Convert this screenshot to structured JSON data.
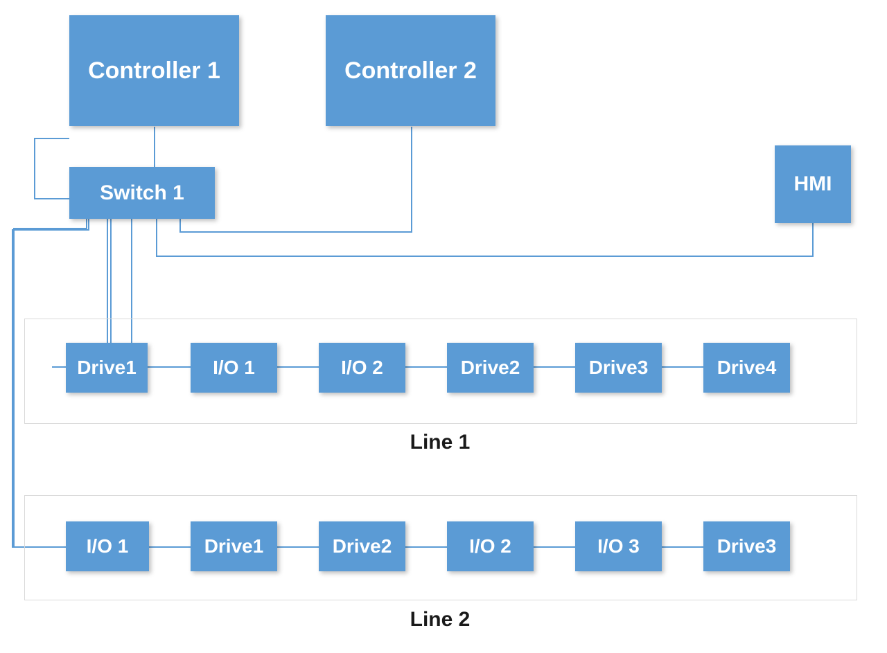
{
  "diagram": {
    "type": "network-topology",
    "nodes": {
      "controller1": {
        "label": "Controller 1",
        "kind": "controller"
      },
      "controller2": {
        "label": "Controller 2",
        "kind": "controller"
      },
      "switch1": {
        "label": "Switch 1",
        "kind": "switch"
      },
      "hmi": {
        "label": "HMI",
        "kind": "hmi"
      }
    },
    "groups": {
      "line1": {
        "label": "Line 1",
        "devices": [
          {
            "id": "l1-drive1",
            "label": "Drive1",
            "kind": "drive"
          },
          {
            "id": "l1-io1",
            "label": "I/O 1",
            "kind": "io"
          },
          {
            "id": "l1-io2",
            "label": "I/O 2",
            "kind": "io"
          },
          {
            "id": "l1-drive2",
            "label": "Drive2",
            "kind": "drive"
          },
          {
            "id": "l1-drive3",
            "label": "Drive3",
            "kind": "drive"
          },
          {
            "id": "l1-drive4",
            "label": "Drive4",
            "kind": "drive"
          }
        ]
      },
      "line2": {
        "label": "Line 2",
        "devices": [
          {
            "id": "l2-io1",
            "label": "I/O 1",
            "kind": "io"
          },
          {
            "id": "l2-drive1",
            "label": "Drive1",
            "kind": "drive"
          },
          {
            "id": "l2-drive2",
            "label": "Drive2",
            "kind": "drive"
          },
          {
            "id": "l2-io2",
            "label": "I/O 2",
            "kind": "io"
          },
          {
            "id": "l2-io3",
            "label": "I/O 3",
            "kind": "io"
          },
          {
            "id": "l2-drive3",
            "label": "Drive3",
            "kind": "drive"
          }
        ]
      }
    },
    "connections": [
      [
        "controller1",
        "switch1"
      ],
      [
        "controller2",
        "switch1"
      ],
      [
        "hmi",
        "switch1"
      ],
      [
        "switch1",
        "line1"
      ],
      [
        "switch1",
        "line2"
      ],
      [
        "l1-drive1",
        "l1-io1"
      ],
      [
        "l1-io1",
        "l1-io2"
      ],
      [
        "l1-io2",
        "l1-drive2"
      ],
      [
        "l1-drive2",
        "l1-drive3"
      ],
      [
        "l1-drive3",
        "l1-drive4"
      ],
      [
        "l2-io1",
        "l2-drive1"
      ],
      [
        "l2-drive1",
        "l2-drive2"
      ],
      [
        "l2-drive2",
        "l2-io2"
      ],
      [
        "l2-io2",
        "l2-io3"
      ],
      [
        "l2-io3",
        "l2-drive3"
      ]
    ],
    "colors": {
      "node_fill": "#5b9bd5",
      "node_text": "#ffffff",
      "wire": "#5b9bd5",
      "group_border": "#d9d9d9",
      "label": "#1a1a1a"
    }
  }
}
